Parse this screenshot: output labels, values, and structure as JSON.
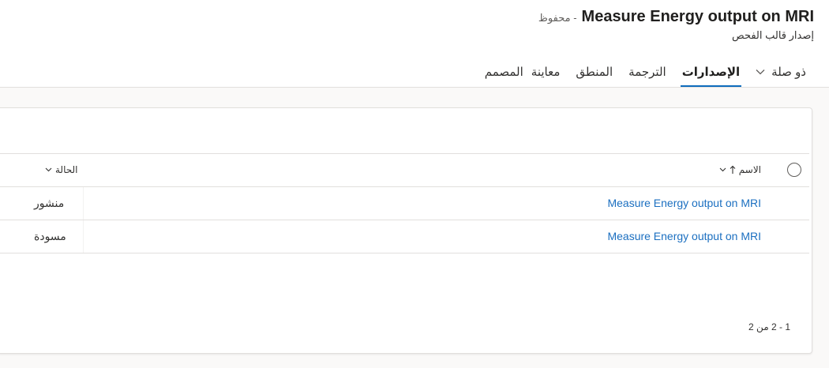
{
  "header": {
    "title": "Measure Energy output on MRI",
    "save_status": "- محفوظ",
    "subtitle": "إصدار قالب الفحص"
  },
  "tabs": [
    {
      "label": "المصمم",
      "active": false
    },
    {
      "label": "معاينة",
      "active": false
    },
    {
      "label": "المنطق",
      "active": false
    },
    {
      "label": "الترجمة",
      "active": false
    },
    {
      "label": "الإصدارات",
      "active": true
    },
    {
      "label": "ذو صلة",
      "active": false,
      "has_dropdown": true
    }
  ],
  "grid": {
    "columns": {
      "name": "الاسم",
      "status": "الحالة"
    },
    "rows": [
      {
        "name": "Measure Energy output on MRI",
        "status": "منشور"
      },
      {
        "name": "Measure Energy output on MRI",
        "status": "مسودة"
      }
    ],
    "pager": "1 - 2 من 2"
  },
  "colors": {
    "accent": "#0f6cbd",
    "link": "#1b6fc0",
    "border": "#e1dfdd",
    "background": "#faf9f8"
  },
  "icons": {
    "sort": "arrow-up-icon",
    "dropdown": "chevron-down-icon",
    "select_all": "circle-checkbox-icon"
  }
}
